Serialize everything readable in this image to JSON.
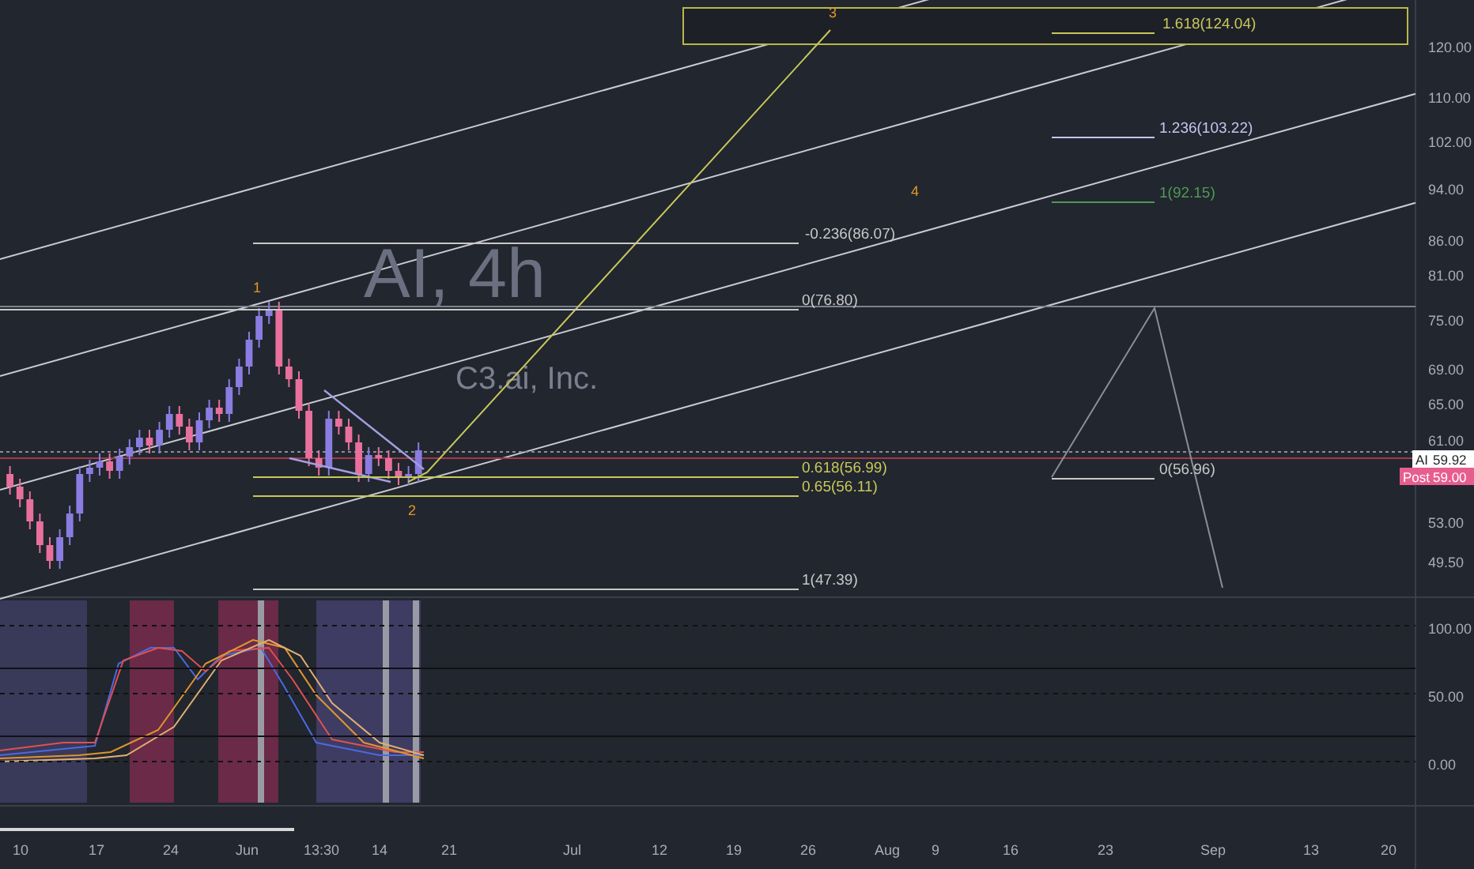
{
  "watermark": {
    "symbol": "AI, 4h",
    "company": "C3.ai, Inc."
  },
  "wave_labels": [
    "1",
    "2",
    "3",
    "4"
  ],
  "fib_levels": [
    {
      "label": "1.618(124.04)",
      "color": "#c8c85a"
    },
    {
      "label": "1.236(103.22)",
      "color": "#c8c4f0"
    },
    {
      "label": "1(92.15)",
      "color": "#4f9a52"
    },
    {
      "label": "-0.236(86.07)",
      "color": "#c8c8c8"
    },
    {
      "label": "0(76.80)",
      "color": "#c8c8c8"
    },
    {
      "label": "0.618(56.99)",
      "color": "#c8c85a"
    },
    {
      "label": "0(56.96)",
      "color": "#c8c8c8"
    },
    {
      "label": "0.65(56.11)",
      "color": "#c8c85a"
    },
    {
      "label": "1(47.39)",
      "color": "#c8c8c8"
    }
  ],
  "price_axis": {
    "ticks": [
      "120.00",
      "110.00",
      "102.00",
      "94.00",
      "86.00",
      "81.00",
      "75.00",
      "69.00",
      "65.00",
      "61.00",
      "53.00",
      "49.50"
    ]
  },
  "price_badges": [
    {
      "kind": "last",
      "symbol": "AI",
      "price": "59.92"
    },
    {
      "kind": "post",
      "symbol": "Post",
      "price": "59.00"
    }
  ],
  "indicator_axis": {
    "ticks": [
      "100.00",
      "50.00",
      "0.00"
    ]
  },
  "time_axis": {
    "ticks": [
      "10",
      "17",
      "24",
      "Jun",
      "13:30",
      "14",
      "21",
      "Jul",
      "12",
      "19",
      "26",
      "Aug",
      "9",
      "16",
      "23",
      "Sep",
      "13",
      "20"
    ]
  }
}
